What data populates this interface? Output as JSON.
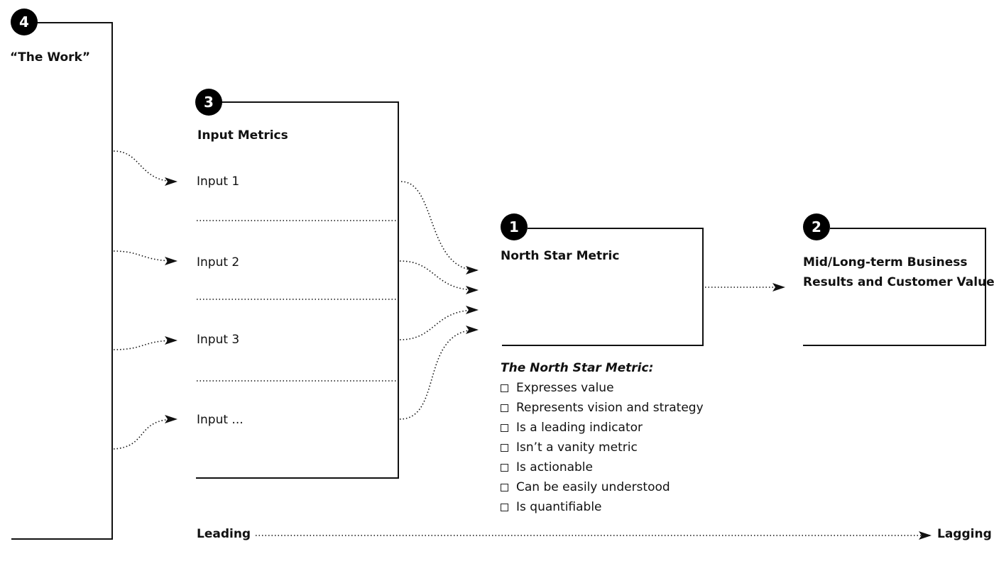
{
  "boxes": {
    "work": {
      "number": "4",
      "title": "“The Work”"
    },
    "inputs": {
      "number": "3",
      "title": "Input Metrics",
      "items": [
        "Input 1",
        "Input 2",
        "Input 3",
        "Input ..."
      ]
    },
    "north_star": {
      "number": "1",
      "title": "North Star Metric"
    },
    "results": {
      "number": "2",
      "title_line1": "Mid/Long-term Business",
      "title_line2": "Results and Customer Value"
    }
  },
  "criteria": {
    "heading": "The North Star Metric:",
    "items": [
      "Expresses value",
      "Represents vision and strategy",
      "Is a leading indicator",
      "Isn’t a vanity metric",
      "Is actionable",
      "Can be easily understood",
      "Is quantifiable"
    ]
  },
  "axis": {
    "start_label": "Leading",
    "end_label": "Lagging"
  },
  "colors": {
    "ink": "#111111",
    "background": "#ffffff"
  }
}
